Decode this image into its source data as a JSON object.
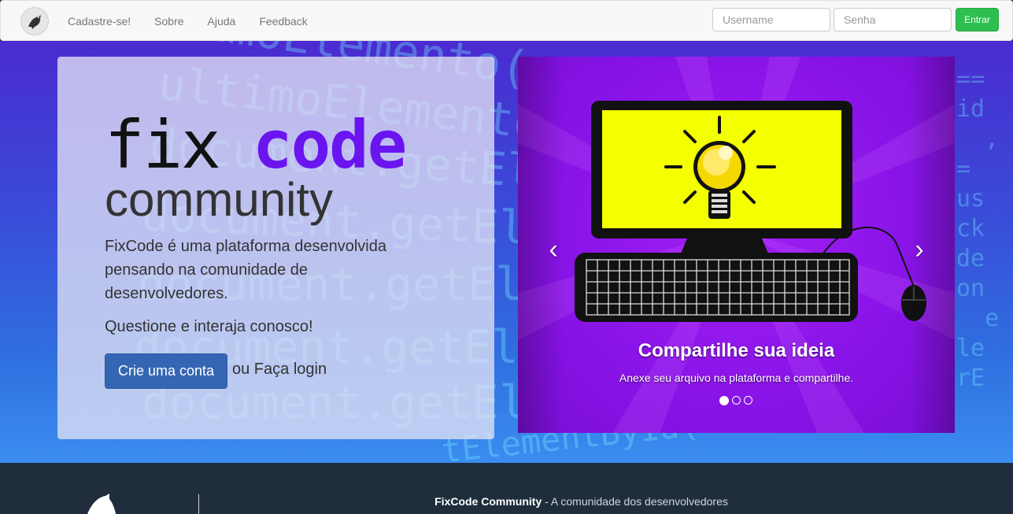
{
  "navbar": {
    "links": [
      "Cadastre-se!",
      "Sobre",
      "Ajuda",
      "Feedback"
    ],
    "username_placeholder": "Username",
    "password_placeholder": "Senha",
    "submit_label": "Entrar"
  },
  "hero": {
    "logo_fix": "fix",
    "logo_code": "code",
    "logo_community": "community",
    "description": "FixCode é uma plataforma desenvolvida pensando na comunidade de desenvolvedores.",
    "subtitle": "Questione e interaja conosco!",
    "cta_label": "Crie uma conta",
    "login_text": "ou Faça login"
  },
  "carousel": {
    "caption_title": "Compartilhe sua ideia",
    "caption_text": "Anexe seu arquivo na plataforma e compartilhe.",
    "prev_icon": "‹",
    "next_icon": "›",
    "active_index": 0,
    "slide_count": 3
  },
  "footer": {
    "brand": "FixCode Community",
    "tagline": " - A comunidade dos desenvolvedores"
  },
  "colors": {
    "brand_purple": "#6a14f0",
    "cta_blue": "#3566b4",
    "submit_green": "#2dbf4f",
    "footer_bg": "#1f2d3d"
  }
}
